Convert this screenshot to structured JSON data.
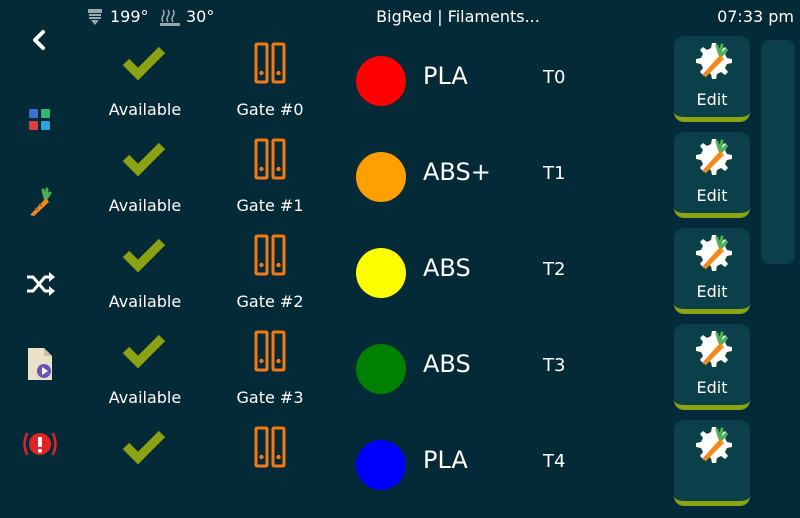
{
  "topbar": {
    "extruder_temp": "199°",
    "bed_temp": "30°",
    "title": "BigRed | Filaments...",
    "time": "07:33 pm"
  },
  "sidebar": {
    "items": [
      {
        "name": "back",
        "icon": "chevron-left-icon"
      },
      {
        "name": "main-menu",
        "icon": "grid-icon"
      },
      {
        "name": "filament",
        "icon": "carrot-icon"
      },
      {
        "name": "mmu",
        "icon": "shuffle-icon"
      },
      {
        "name": "print-file",
        "icon": "file-play-icon"
      },
      {
        "name": "emergency-stop",
        "icon": "alert-icon"
      }
    ]
  },
  "colors": {
    "accent_check": "#8aa313",
    "gate_icon": "#f07a1a",
    "button_bg": "#0b3f4a",
    "background": "#032a36"
  },
  "gates": [
    {
      "status": "Available",
      "gate": "Gate #0",
      "color": "#ff0000",
      "material": "PLA",
      "tool": "T0",
      "edit": "Edit"
    },
    {
      "status": "Available",
      "gate": "Gate #1",
      "color": "#ff9f00",
      "material": "ABS+",
      "tool": "T1",
      "edit": "Edit"
    },
    {
      "status": "Available",
      "gate": "Gate #2",
      "color": "#ffff00",
      "material": "ABS",
      "tool": "T2",
      "edit": "Edit"
    },
    {
      "status": "Available",
      "gate": "Gate #3",
      "color": "#008000",
      "material": "ABS",
      "tool": "T3",
      "edit": "Edit"
    },
    {
      "status": "",
      "gate": "",
      "color": "#0000ff",
      "material": "PLA",
      "tool": "T4",
      "edit": ""
    }
  ]
}
